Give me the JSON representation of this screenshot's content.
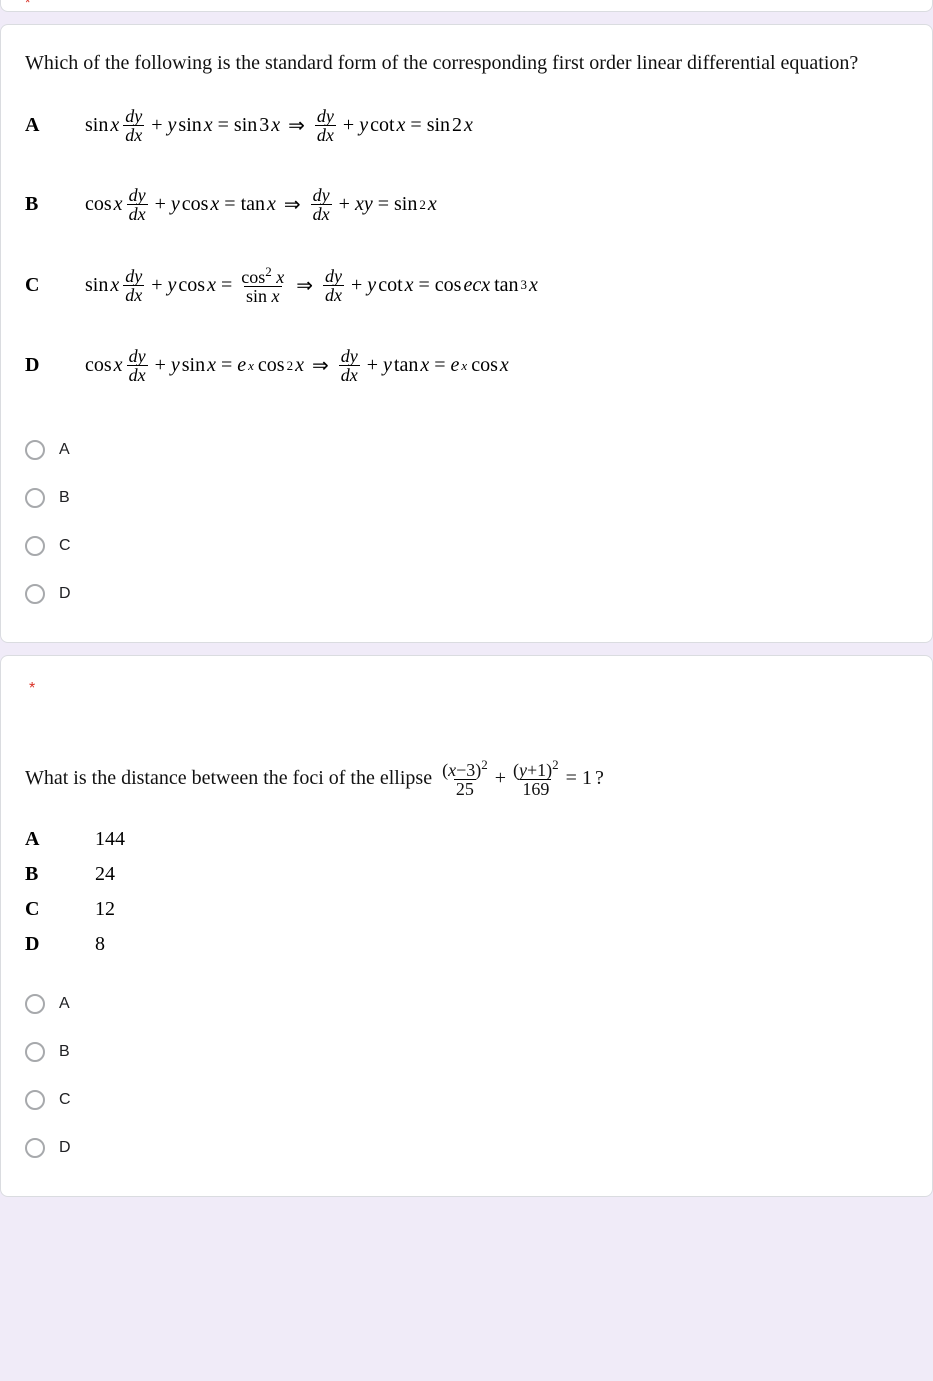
{
  "q1": {
    "prompt": "Which of the following is the standard form of the corresponding first order linear differential equation?",
    "options": {
      "A": {
        "label": "A"
      },
      "B": {
        "label": "B"
      },
      "C": {
        "label": "C"
      },
      "D": {
        "label": "D"
      }
    },
    "radios": {
      "A": "A",
      "B": "B",
      "C": "C",
      "D": "D"
    },
    "math": {
      "sin": "sin",
      "cos": "cos",
      "tan": "tan",
      "cot": "cot",
      "cosec": "cos",
      "ecx": "ecx",
      "x": "x",
      "y": "y",
      "dy": "dy",
      "dx": "dx",
      "e": "e",
      "plus": "+",
      "eq": "=",
      "imp": "⇒",
      "two": "2",
      "three": "3",
      "sq": "2",
      "cube": "3",
      "xpow": "x"
    }
  },
  "q2": {
    "required": "*",
    "prompt_pre": "What is the distance between the foci of the ellipse ",
    "prompt_post": " ?",
    "ellipse": {
      "n1a": "(",
      "n1x": "x",
      "n1op": "−",
      "n1c": "3",
      "n1b": ")",
      "p1": "2",
      "d1": "25",
      "plus": "+",
      "n2a": "(",
      "n2y": "y",
      "n2op": "+",
      "n2c": "1",
      "n2b": ")",
      "p2": "2",
      "d2": "169",
      "eq": "= 1"
    },
    "options": {
      "A": {
        "label": "A",
        "value": "144"
      },
      "B": {
        "label": "B",
        "value": "24"
      },
      "C": {
        "label": "C",
        "value": "12"
      },
      "D": {
        "label": "D",
        "value": "8"
      }
    },
    "radios": {
      "A": "A",
      "B": "B",
      "C": "C",
      "D": "D"
    }
  }
}
